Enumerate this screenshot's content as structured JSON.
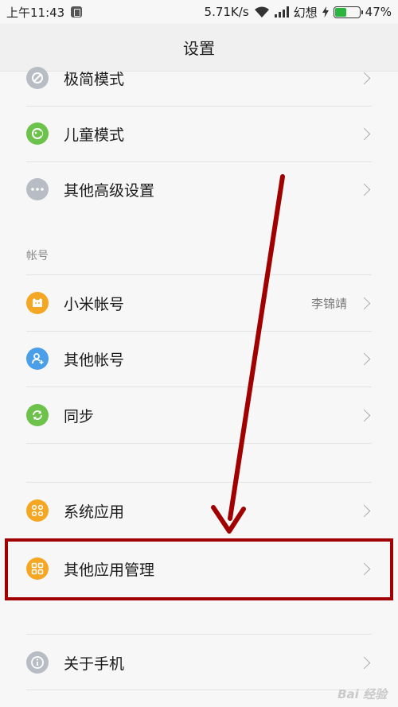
{
  "status_bar": {
    "time": "上午11:43",
    "speed": "5.71K/s",
    "carrier": "幻想",
    "battery": "47%",
    "battery_level": 0.47
  },
  "header": {
    "title": "设置"
  },
  "rows": {
    "minimal_mode": {
      "label": "极简模式"
    },
    "kids_mode": {
      "label": "儿童模式"
    },
    "other_advanced": {
      "label": "其他高级设置"
    },
    "mi_account": {
      "label": "小米帐号",
      "value": "李锦靖"
    },
    "other_accounts": {
      "label": "其他帐号"
    },
    "sync": {
      "label": "同步"
    },
    "system_apps": {
      "label": "系统应用"
    },
    "other_apps": {
      "label": "其他应用管理"
    },
    "about_phone": {
      "label": "关于手机"
    }
  },
  "sections": {
    "accounts": "帐号"
  },
  "colors": {
    "accent_red": "#a00000",
    "orange": "#f5a623",
    "green": "#6cc24a",
    "blue": "#4a9fe8",
    "gray": "#b8bcc4"
  },
  "watermark": "Bai 经验"
}
